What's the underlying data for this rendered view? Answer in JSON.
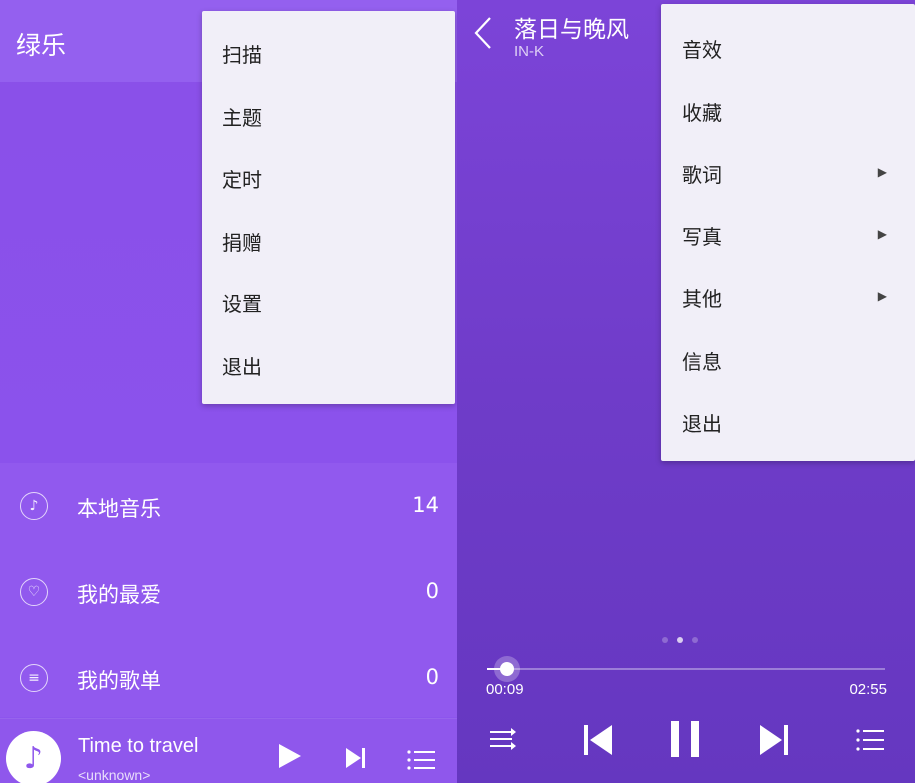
{
  "left": {
    "app_title": "绿乐",
    "overflow_menu": [
      "扫描",
      "主题",
      "定时",
      "捐赠",
      "设置",
      "退出"
    ],
    "library": [
      {
        "label": "本地音乐",
        "count": "14",
        "icon": "music-note-icon"
      },
      {
        "label": "我的最爱",
        "count": "0",
        "icon": "heart-icon"
      },
      {
        "label": "我的歌单",
        "count": "0",
        "icon": "list-icon"
      }
    ],
    "mini_player": {
      "title": "Time to travel",
      "artist": "<unknown>"
    }
  },
  "right": {
    "song_title": "落日与晚风",
    "song_artist": "IN-K",
    "overflow_menu": [
      {
        "label": "音效",
        "submenu": false
      },
      {
        "label": "收藏",
        "submenu": false
      },
      {
        "label": "歌词",
        "submenu": true
      },
      {
        "label": "写真",
        "submenu": true
      },
      {
        "label": "其他",
        "submenu": true
      },
      {
        "label": "信息",
        "submenu": false
      },
      {
        "label": "退出",
        "submenu": false
      }
    ],
    "time_current": "00:09",
    "time_total": "02:55",
    "progress": 0.05,
    "page_indicator": {
      "count": 3,
      "active": 1
    }
  },
  "colors": {
    "background_left": "#8b52ec",
    "background_right": "#6f3cc9",
    "menu_bg": "#f1eff8"
  }
}
